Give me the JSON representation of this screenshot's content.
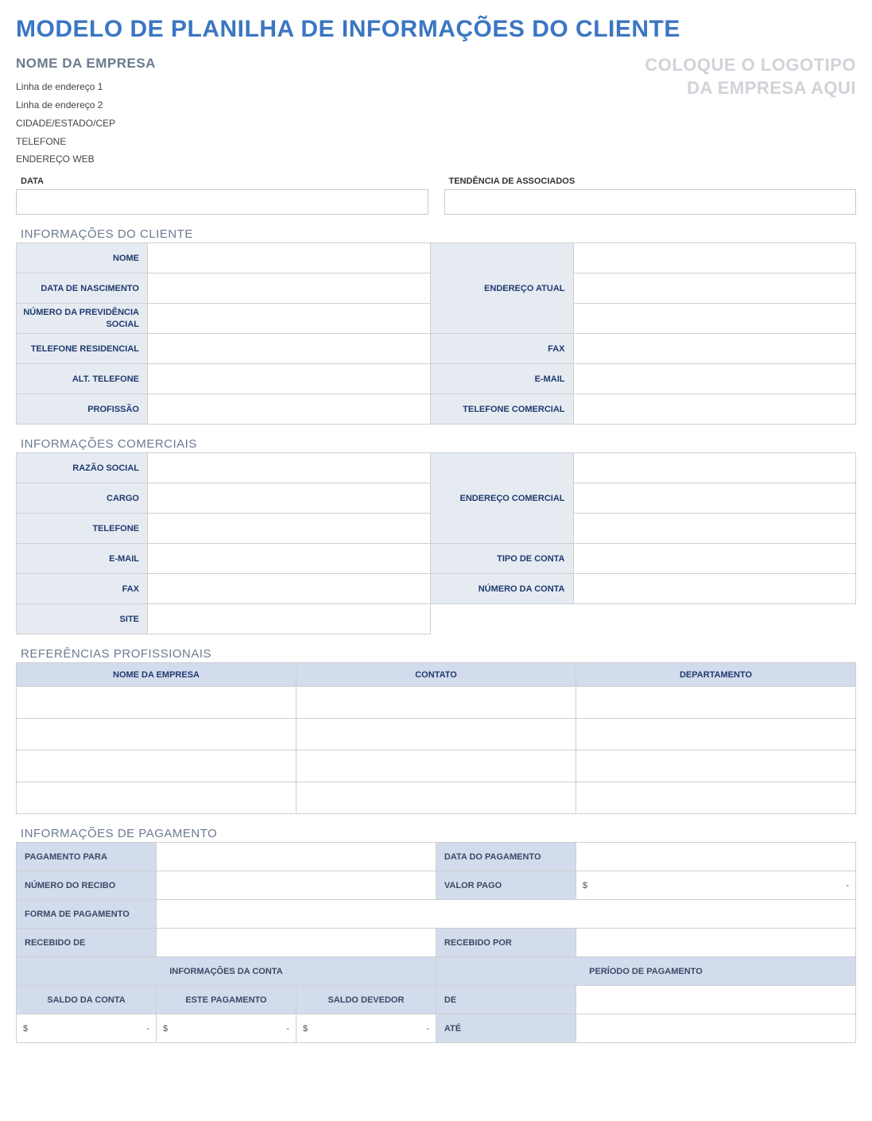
{
  "title": "MODELO DE PLANILHA DE INFORMAÇÕES DO CLIENTE",
  "company": {
    "name_label": "NOME DA EMPRESA",
    "addr1": "Linha de endereço 1",
    "addr2": "Linha de endereço 2",
    "city": "CIDADE/ESTADO/CEP",
    "phone": "TELEFONE",
    "web": "ENDEREÇO WEB"
  },
  "logo": {
    "line1": "COLOQUE O LOGOTIPO",
    "line2": "DA EMPRESA AQUI"
  },
  "meta": {
    "date_label": "DATA",
    "assoc_label": "TENDÊNCIA DE ASSOCIADOS"
  },
  "sections": {
    "client": "INFORMAÇÕES DO CLIENTE",
    "business": "INFORMAÇÕES COMERCIAIS",
    "refs": "REFERÊNCIAS PROFISSIONAIS",
    "payment": "INFORMAÇÕES DE PAGAMENTO"
  },
  "client": {
    "name": "NOME",
    "dob": "DATA DE NASCIMENTO",
    "ssn": "NÚMERO DA PREVIDÊNCIA SOCIAL",
    "home_phone": "TELEFONE RESIDENCIAL",
    "alt_phone": "ALT. TELEFONE",
    "profession": "PROFISSÃO",
    "cur_addr": "ENDEREÇO ATUAL",
    "fax": "FAX",
    "email": "E-MAIL",
    "work_phone": "TELEFONE COMERCIAL"
  },
  "business": {
    "legal_name": "RAZÃO SOCIAL",
    "role": "CARGO",
    "phone": "TELEFONE",
    "email": "E-MAIL",
    "fax": "FAX",
    "site": "SITE",
    "addr": "ENDEREÇO COMERCIAL",
    "acct_type": "TIPO DE CONTA",
    "acct_num": "NÚMERO DA CONTA"
  },
  "refs": {
    "company": "NOME DA EMPRESA",
    "contact": "CONTATO",
    "dept": "DEPARTAMENTO"
  },
  "payment": {
    "pay_to": "PAGAMENTO PARA",
    "pay_date": "DATA DO PAGAMENTO",
    "receipt_no": "NÚMERO DO RECIBO",
    "amount_paid": "VALOR PAGO",
    "method": "FORMA DE PAGAMENTO",
    "received_from": "RECEBIDO DE",
    "received_by": "RECEBIDO POR",
    "acct_info": "INFORMAÇÕES DA CONTA",
    "pay_period": "PERÍODO DE PAGAMENTO",
    "acct_balance": "SALDO DA CONTA",
    "this_payment": "ESTE PAGAMENTO",
    "balance_due": "SALDO DEVEDOR",
    "from": "DE",
    "to": "ATÉ",
    "currency": "$",
    "dash": "-"
  }
}
